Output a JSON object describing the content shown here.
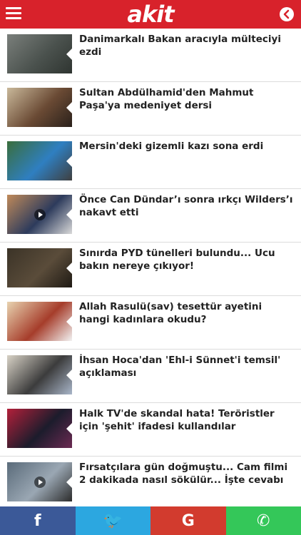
{
  "header": {
    "logo_text": "akit",
    "menu_icon": "hamburger-menu-icon",
    "back_icon": "chevron-left-circle-icon",
    "color": "#d8222b"
  },
  "news": [
    {
      "title": "Danimarkalı Bakan aracıyla mülteciyi ezdi",
      "thumb_colors": [
        "#7a7f7b",
        "#4b524e",
        "#2f3531"
      ],
      "has_video": false
    },
    {
      "title": "Sultan Abdülhamid'den Mahmut Paşa'ya medeniyet dersi",
      "thumb_colors": [
        "#c9b89a",
        "#6a4a34",
        "#2a211b"
      ],
      "has_video": false
    },
    {
      "title": "Mersin'deki gizemli kazı sona erdi",
      "thumb_colors": [
        "#3a6e3c",
        "#2f7fc1",
        "#3f3f3f"
      ],
      "has_video": false
    },
    {
      "title": "Önce Can Dündar’ı sonra ırkçı Wilders’ı nakavt etti",
      "thumb_colors": [
        "#c08a5a",
        "#2d3b5c",
        "#d9d9d9"
      ],
      "has_video": true
    },
    {
      "title": "Sınırda PYD tünelleri bulundu... Ucu bakın nereye çıkıyor!",
      "thumb_colors": [
        "#3b3327",
        "#5a4c3a",
        "#1f1a14"
      ],
      "has_video": false
    },
    {
      "title": "Allah Rasulü(sav) tesettür ayetini hangi kadınlara okudu?",
      "thumb_colors": [
        "#e8d3b0",
        "#a63d2b",
        "#f2f2f2"
      ],
      "has_video": false
    },
    {
      "title": "İhsan Hoca'dan 'Ehl-i Sünnet'i temsil' açıklaması",
      "thumb_colors": [
        "#d8d2c6",
        "#3c3c3c",
        "#a9b6c9"
      ],
      "has_video": false
    },
    {
      "title": "Halk TV'de skandal hata! Teröristler için 'şehit' ifadesi kullandılar",
      "thumb_colors": [
        "#b3203a",
        "#1c1c2c",
        "#6b2a52"
      ],
      "has_video": false
    },
    {
      "title": "Fırsatçılara gün doğmuştu... Cam filmi 2 dakikada nasıl sökülür... İşte cevabı",
      "thumb_colors": [
        "#5a6b7a",
        "#9aa7b3",
        "#2c2c2c"
      ],
      "has_video": true
    }
  ],
  "share": [
    {
      "name": "facebook-share-button",
      "icon": "facebook-icon",
      "glyph": "f",
      "color": "#3b5998"
    },
    {
      "name": "twitter-share-button",
      "icon": "twitter-icon",
      "glyph": "🐦",
      "color": "#2ca7e0"
    },
    {
      "name": "google-share-button",
      "icon": "google-icon",
      "glyph": "G",
      "color": "#d23b2e"
    },
    {
      "name": "whatsapp-share-button",
      "icon": "whatsapp-icon",
      "glyph": "✆",
      "color": "#34c759"
    }
  ]
}
